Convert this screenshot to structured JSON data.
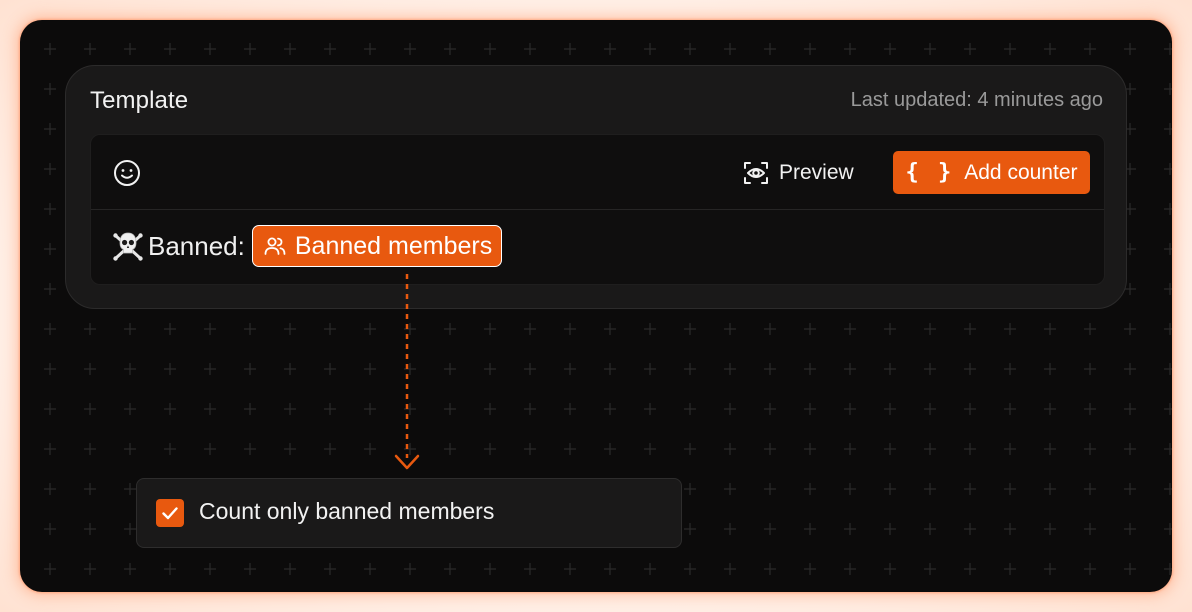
{
  "card": {
    "title": "Template",
    "last_updated": "Last updated: 4 minutes ago"
  },
  "toolbar": {
    "emoji_icon": "smiley-icon",
    "preview_label": "Preview",
    "preview_icon": "eye-scan-icon",
    "add_counter_label": "Add counter",
    "add_counter_icon": "braces-icon",
    "add_counter_glyph": "{ }"
  },
  "content": {
    "prefix_icon": "skull-crossbones-icon",
    "prefix_text": "Banned:",
    "chip_label": "Banned members",
    "chip_icon": "users-icon"
  },
  "option": {
    "label": "Count only banned members",
    "checked": true
  },
  "colors": {
    "accent": "#e8590f",
    "background": "#0c0b0b",
    "card": "#1a1919",
    "muted_text": "#9a9a9a"
  }
}
